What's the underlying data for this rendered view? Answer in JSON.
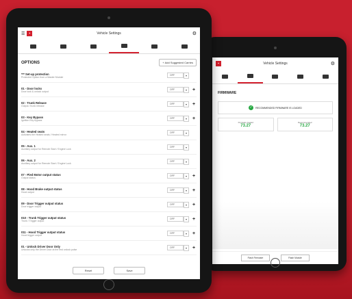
{
  "header": {
    "title": "Vehicle Settings"
  },
  "tabs": [
    "vehicle",
    "car",
    "remote",
    "module",
    "door",
    "options"
  ],
  "options": {
    "title": "OPTIONS",
    "add_button": "+ Add Suggested Carries",
    "rows": [
      {
        "name": "*** Set-up protection",
        "desc": "Protected Option from a Master Module",
        "value": "OFF",
        "plus": false
      },
      {
        "name": "01 - Door locks",
        "desc": "Door lock & unlock output",
        "value": "OFF",
        "plus": true
      },
      {
        "name": "02 - Trunk Release",
        "desc": "Output / trunk release",
        "value": "OFF",
        "plus": true
      },
      {
        "name": "03 - Key Bypass",
        "desc": "Ignition Key bypass",
        "value": "OFF",
        "plus": true
      },
      {
        "name": "04 - Heated seats",
        "desc": "Activates the Heated seats / Heated mirror",
        "value": "OFF",
        "plus": false
      },
      {
        "name": "05 - Aux. 1",
        "desc": "Auxiliary output for Remote Start / Engine Lock",
        "value": "OFF",
        "plus": false
      },
      {
        "name": "06 - Aux. 2",
        "desc": "Auxiliary output for Remote Start / Engine Lock",
        "value": "OFF",
        "plus": false
      },
      {
        "name": "07 - Pied Motor output status",
        "desc": "Output status",
        "value": "OFF",
        "plus": true
      },
      {
        "name": "08 - Hood Brake output status",
        "desc": "Hood output",
        "value": "OFF",
        "plus": true
      },
      {
        "name": "09 - Door Trigger output status",
        "desc": "Door trigger output",
        "value": "OFF",
        "plus": true
      },
      {
        "name": "010 - Trunk Trigger output status",
        "desc": "Trunk / Trigger output",
        "value": "OFF",
        "plus": true
      },
      {
        "name": "011 - Hood Trigger output status",
        "desc": "Hood trigger output",
        "value": "OFF",
        "plus": true
      },
      {
        "name": "01 - Unlock Driver Door Only",
        "desc": "Unlocks only the Driver Door at the first unlock pulse",
        "value": "OFF",
        "plus": true
      }
    ],
    "footer": [
      "Reset",
      "Save"
    ]
  },
  "firmware": {
    "title": "FIRMWARE",
    "recommended_text": "RECOMMENDED FIRMWARE IS LOADED",
    "current_label": "Firmware loaded",
    "current_value": "73.27",
    "recommended_label": "Recommended",
    "recommended_value": "73.27",
    "footer": [
      "Flash Firmware",
      "Flash Module"
    ]
  },
  "colors": {
    "accent": "#d3202e",
    "success": "#27a843",
    "background": "#c8202e"
  }
}
